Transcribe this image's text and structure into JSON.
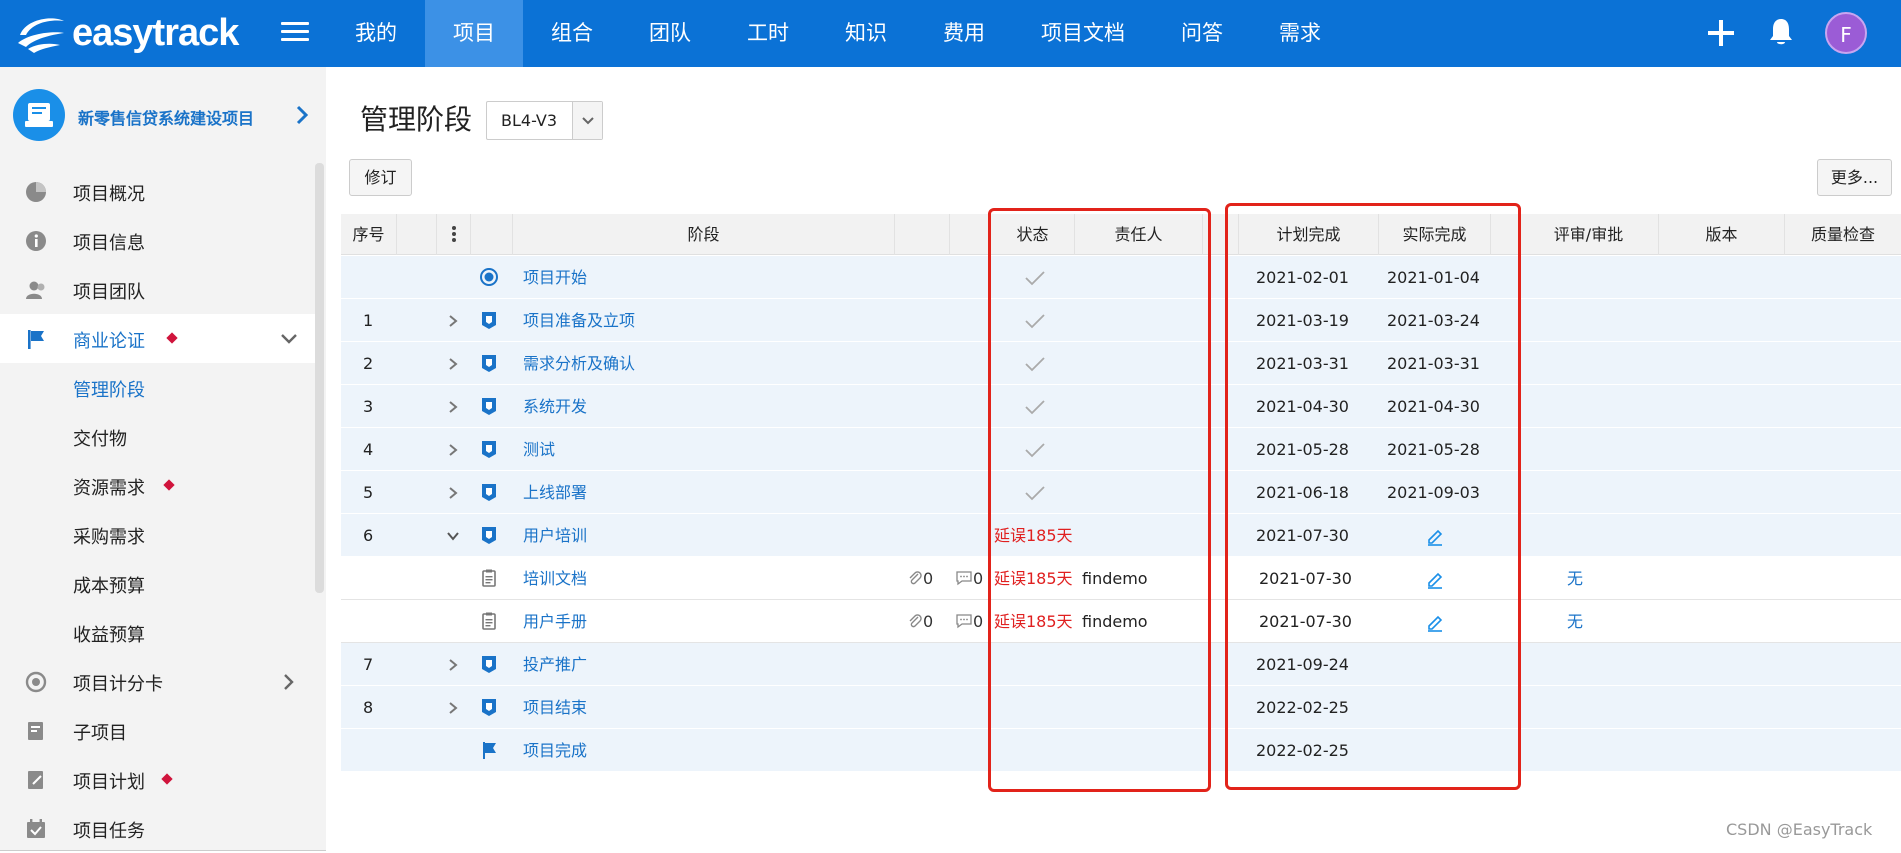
{
  "brand": {
    "logo_text": "easytrack",
    "primary": "#0b72d6",
    "alert_red": "#e02020"
  },
  "nav": {
    "items": [
      "我的",
      "项目",
      "组合",
      "团队",
      "工时",
      "知识",
      "费用",
      "项目文档",
      "问答",
      "需求"
    ],
    "active_index": 1
  },
  "user": {
    "avatar_initial": "F"
  },
  "sidebar": {
    "project_name": "新零售信贷系统建设项目",
    "items": [
      {
        "label": "项目概况",
        "icon": "pie-chart-icon"
      },
      {
        "label": "项目信息",
        "icon": "info-icon"
      },
      {
        "label": "项目团队",
        "icon": "team-icon"
      },
      {
        "label": "商业论证",
        "icon": "flag-icon"
      },
      {
        "label": "项目计分卡",
        "icon": "target-icon"
      },
      {
        "label": "子项目",
        "icon": "subproject-icon"
      },
      {
        "label": "项目计划",
        "icon": "plan-icon"
      },
      {
        "label": "项目任务",
        "icon": "task-icon"
      }
    ],
    "sub_items": [
      "管理阶段",
      "交付物",
      "资源需求",
      "采购需求",
      "成本预算",
      "收益预算"
    ]
  },
  "page": {
    "title": "管理阶段",
    "version": "BL4-V3",
    "revise_label": "修订",
    "more_label": "更多..."
  },
  "table": {
    "headers": {
      "no": "序号",
      "stage": "阶段",
      "status": "状态",
      "owner": "责任人",
      "plan": "计划完成",
      "actual": "实际完成",
      "review": "评审/审批",
      "version": "版本",
      "quality": "质量检查"
    },
    "rows": [
      {
        "no": "",
        "name": "项目开始",
        "icon": "milestone-start-icon",
        "expand": "",
        "status": "check",
        "status_text": "",
        "owner": "",
        "plan": "2021-02-01",
        "actual": "2021-01-04",
        "attach": "",
        "comment": "",
        "review": "",
        "white": false,
        "edit": false
      },
      {
        "no": "1",
        "name": "项目准备及立项",
        "icon": "stage-icon",
        "expand": "right",
        "status": "check",
        "status_text": "",
        "owner": "",
        "plan": "2021-03-19",
        "actual": "2021-03-24",
        "attach": "",
        "comment": "",
        "review": "",
        "white": false,
        "edit": false
      },
      {
        "no": "2",
        "name": "需求分析及确认",
        "icon": "stage-icon",
        "expand": "right",
        "status": "check",
        "status_text": "",
        "owner": "",
        "plan": "2021-03-31",
        "actual": "2021-03-31",
        "attach": "",
        "comment": "",
        "review": "",
        "white": false,
        "edit": false
      },
      {
        "no": "3",
        "name": "系统开发",
        "icon": "stage-icon",
        "expand": "right",
        "status": "check",
        "status_text": "",
        "owner": "",
        "plan": "2021-04-30",
        "actual": "2021-04-30",
        "attach": "",
        "comment": "",
        "review": "",
        "white": false,
        "edit": false
      },
      {
        "no": "4",
        "name": "测试",
        "icon": "stage-icon",
        "expand": "right",
        "status": "check",
        "status_text": "",
        "owner": "",
        "plan": "2021-05-28",
        "actual": "2021-05-28",
        "attach": "",
        "comment": "",
        "review": "",
        "white": false,
        "edit": false
      },
      {
        "no": "5",
        "name": "上线部署",
        "icon": "stage-icon",
        "expand": "right",
        "status": "check",
        "status_text": "",
        "owner": "",
        "plan": "2021-06-18",
        "actual": "2021-09-03",
        "attach": "",
        "comment": "",
        "review": "",
        "white": false,
        "edit": false
      },
      {
        "no": "6",
        "name": "用户培训",
        "icon": "stage-icon",
        "expand": "down",
        "status": "text",
        "status_text": "延误185天",
        "owner": "",
        "plan": "2021-07-30",
        "actual": "",
        "attach": "",
        "comment": "",
        "review": "",
        "white": false,
        "edit": true
      },
      {
        "no": "",
        "name": "培训文档",
        "icon": "document-icon",
        "expand": "",
        "status": "text",
        "status_text": "延误185天",
        "owner": "findemo",
        "plan": "2021-07-30",
        "actual": "",
        "attach": "0",
        "comment": "0",
        "review": "无",
        "white": true,
        "edit": true
      },
      {
        "no": "",
        "name": "用户手册",
        "icon": "document-icon",
        "expand": "",
        "status": "text",
        "status_text": "延误185天",
        "owner": "findemo",
        "plan": "2021-07-30",
        "actual": "",
        "attach": "0",
        "comment": "0",
        "review": "无",
        "white": true,
        "edit": true
      },
      {
        "no": "7",
        "name": "投产推广",
        "icon": "stage-icon",
        "expand": "right",
        "status": "",
        "status_text": "",
        "owner": "",
        "plan": "2021-09-24",
        "actual": "",
        "attach": "",
        "comment": "",
        "review": "",
        "white": false,
        "edit": false
      },
      {
        "no": "8",
        "name": "项目结束",
        "icon": "stage-icon",
        "expand": "right",
        "status": "",
        "status_text": "",
        "owner": "",
        "plan": "2022-02-25",
        "actual": "",
        "attach": "",
        "comment": "",
        "review": "",
        "white": false,
        "edit": false
      },
      {
        "no": "",
        "name": "项目完成",
        "icon": "finish-flag-icon",
        "expand": "",
        "status": "",
        "status_text": "",
        "owner": "",
        "plan": "2022-02-25",
        "actual": "",
        "attach": "",
        "comment": "",
        "review": "",
        "white": false,
        "edit": false
      }
    ]
  },
  "watermark": "CSDN @EasyTrack"
}
